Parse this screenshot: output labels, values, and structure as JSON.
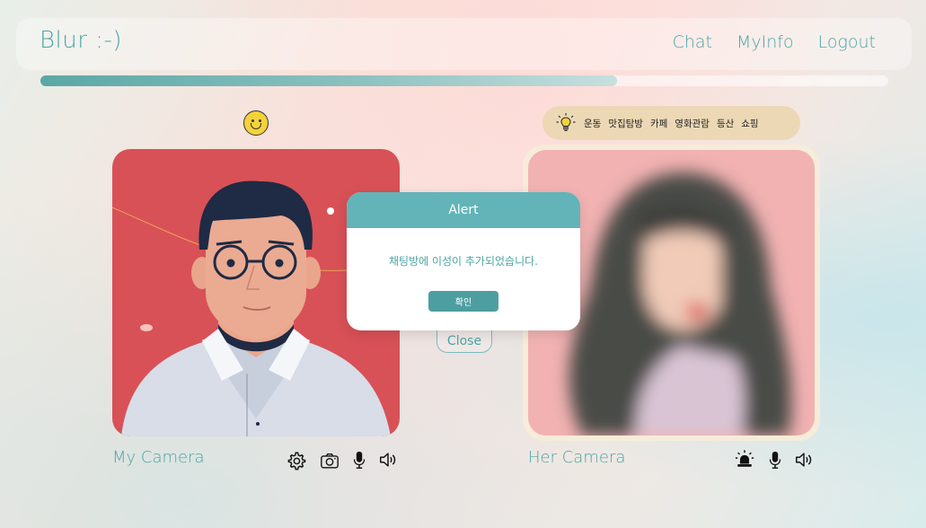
{
  "header": {
    "brand": "Blur :-)",
    "nav": [
      "Chat",
      "MyInfo",
      "Logout"
    ]
  },
  "progress": {
    "value_percent": 68
  },
  "interests": {
    "icon": "lightbulb-icon",
    "tags": [
      "운동",
      "맛집탐방",
      "카페",
      "영화관람",
      "등산",
      "쇼핑"
    ]
  },
  "my_camera": {
    "label": "My Camera",
    "controls": [
      "gear-icon",
      "camera-icon",
      "microphone-icon",
      "speaker-icon"
    ]
  },
  "her_camera": {
    "label": "Her Camera",
    "controls": [
      "siren-icon",
      "microphone-icon",
      "speaker-icon"
    ]
  },
  "modal": {
    "title": "Alert",
    "message": "채팅방에 이성이 추가되었습니다.",
    "confirm": "확인"
  },
  "close_label": "Close",
  "colors": {
    "accent": "#4aa5a5",
    "modal_header": "#62b4b8",
    "my_cam_bg": "#d85157",
    "interest_bg": "#ecd8b5"
  }
}
